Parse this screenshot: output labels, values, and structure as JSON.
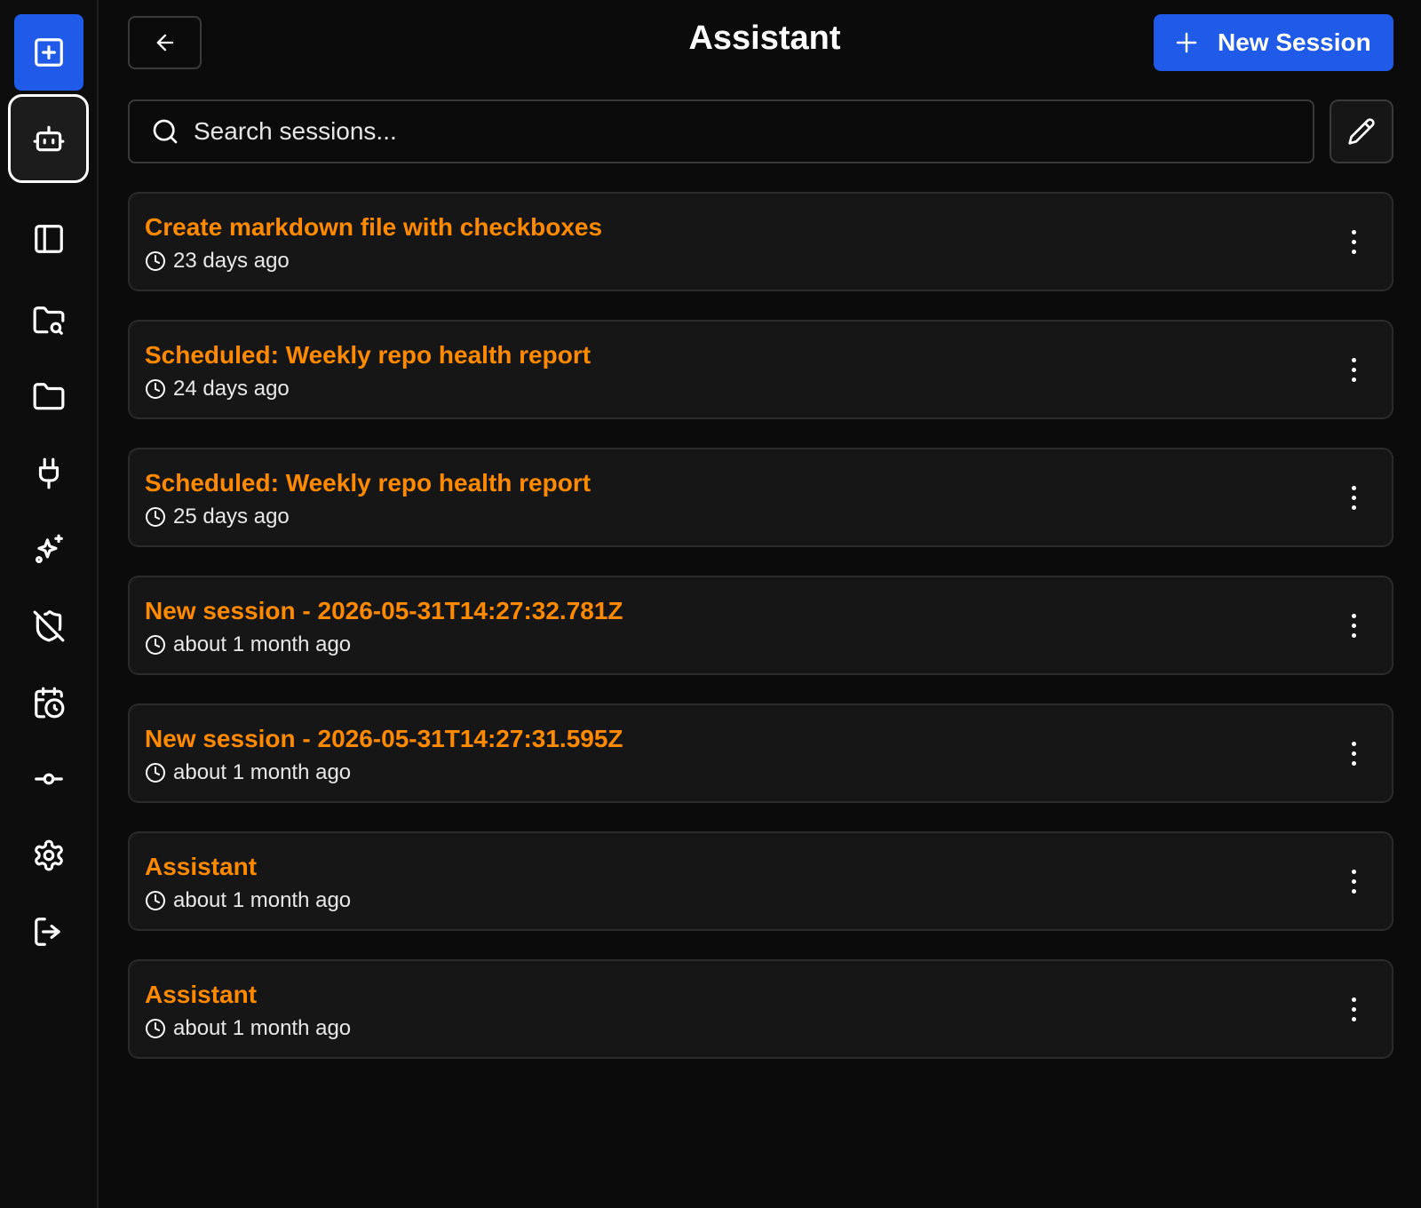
{
  "header": {
    "title": "Assistant",
    "new_session_label": "New Session"
  },
  "search": {
    "placeholder": "Search sessions...",
    "value": ""
  },
  "sidebar": {
    "items": [
      {
        "icon": "new-chat-icon"
      },
      {
        "icon": "bot-icon",
        "active": true
      },
      {
        "icon": "panel-icon"
      },
      {
        "icon": "folder-search-icon"
      },
      {
        "icon": "folder-icon"
      },
      {
        "icon": "plug-icon"
      },
      {
        "icon": "sparkles-icon"
      },
      {
        "icon": "shield-off-icon"
      },
      {
        "icon": "calendar-clock-icon"
      },
      {
        "icon": "commit-icon"
      },
      {
        "icon": "settings-icon"
      },
      {
        "icon": "logout-icon"
      }
    ]
  },
  "sessions": [
    {
      "title": "Create markdown file with checkboxes",
      "time": "23 days ago"
    },
    {
      "title": "Scheduled: Weekly repo health report",
      "time": "24 days ago"
    },
    {
      "title": "Scheduled: Weekly repo health report",
      "time": "25 days ago"
    },
    {
      "title": "New session - 2026-05-31T14:27:32.781Z",
      "time": "about 1 month ago"
    },
    {
      "title": "New session - 2026-05-31T14:27:31.595Z",
      "time": "about 1 month ago"
    },
    {
      "title": "Assistant",
      "time": "about 1 month ago"
    },
    {
      "title": "Assistant",
      "time": "about 1 month ago"
    }
  ],
  "colors": {
    "accent": "#1f5ae8",
    "session_title": "#ff8a00",
    "background": "#0b0b0b",
    "card": "#161616"
  }
}
